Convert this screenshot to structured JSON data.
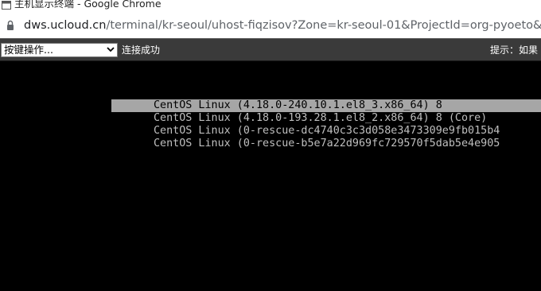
{
  "window": {
    "title": "主机显示终端 - Google Chrome"
  },
  "address_bar": {
    "url_host": "dws.ucloud.cn",
    "url_path": "/terminal/kr-seoul/uhost-fiqzisov?Zone=kr-seoul-01&ProjectId=org-pyoeto&_tem"
  },
  "toolbar": {
    "key_select_value": "按键操作...",
    "status_text": "连接成功",
    "hint_text": "提示：如果"
  },
  "terminal": {
    "boot_entries": [
      {
        "label": "CentOS Linux (4.18.0-240.10.1.el8_3.x86_64) 8",
        "selected": true
      },
      {
        "label": "CentOS Linux (4.18.0-193.28.1.el8_2.x86_64) 8 (Core)",
        "selected": false
      },
      {
        "label": "CentOS Linux (0-rescue-dc4740c3c3d058e3473309e9fb015b4",
        "selected": false
      },
      {
        "label": "CentOS Linux (0-rescue-b5e7a22d969fc729570f5dab5e4e905",
        "selected": false
      }
    ]
  },
  "colors": {
    "terminal_bg": "#000000",
    "terminal_text": "#bfbfbf",
    "selection_bg": "#a6a6a6",
    "toolbar_bg": "#3a3a3a"
  }
}
